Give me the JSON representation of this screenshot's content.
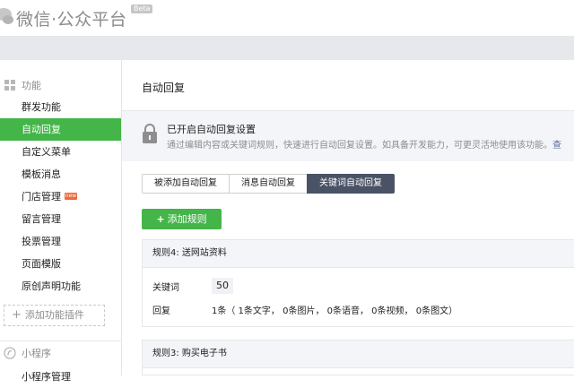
{
  "header": {
    "brand": "微信·公众平台",
    "beta": "Beta"
  },
  "sidebar": {
    "section_features": "功能",
    "items": [
      {
        "label": "群发功能"
      },
      {
        "label": "自动回复",
        "active": true
      },
      {
        "label": "自定义菜单"
      },
      {
        "label": "模板消息"
      },
      {
        "label": "门店管理",
        "badge": "new"
      },
      {
        "label": "留言管理"
      },
      {
        "label": "投票管理"
      },
      {
        "label": "页面模版"
      },
      {
        "label": "原创声明功能"
      }
    ],
    "add_plugin": "添加功能插件",
    "section_miniprogram": "小程序",
    "mini_item": "小程序管理"
  },
  "main": {
    "title": "自动回复",
    "notice": {
      "title": "已开启自动回复设置",
      "desc": "通过编辑内容或关键词规则，快速进行自动回复设置。如具备开发能力，可更灵活地使用该功能。",
      "link": "查"
    },
    "tabs": [
      "被添加自动回复",
      "消息自动回复",
      "关键词自动回复"
    ],
    "active_tab": 2,
    "add_rule": "添加规则",
    "rules": [
      {
        "title": "规则4: 送网站资料",
        "keyword_label": "关键词",
        "keyword": "50",
        "reply_label": "回复",
        "reply": "1条（ 1条文字， 0条图片， 0条语音， 0条视频， 0条图文）"
      },
      {
        "title": "规则3: 购买电子书"
      }
    ]
  },
  "colors": {
    "accent_green": "#44b549",
    "tab_active": "#4a5266",
    "link": "#576b95"
  }
}
